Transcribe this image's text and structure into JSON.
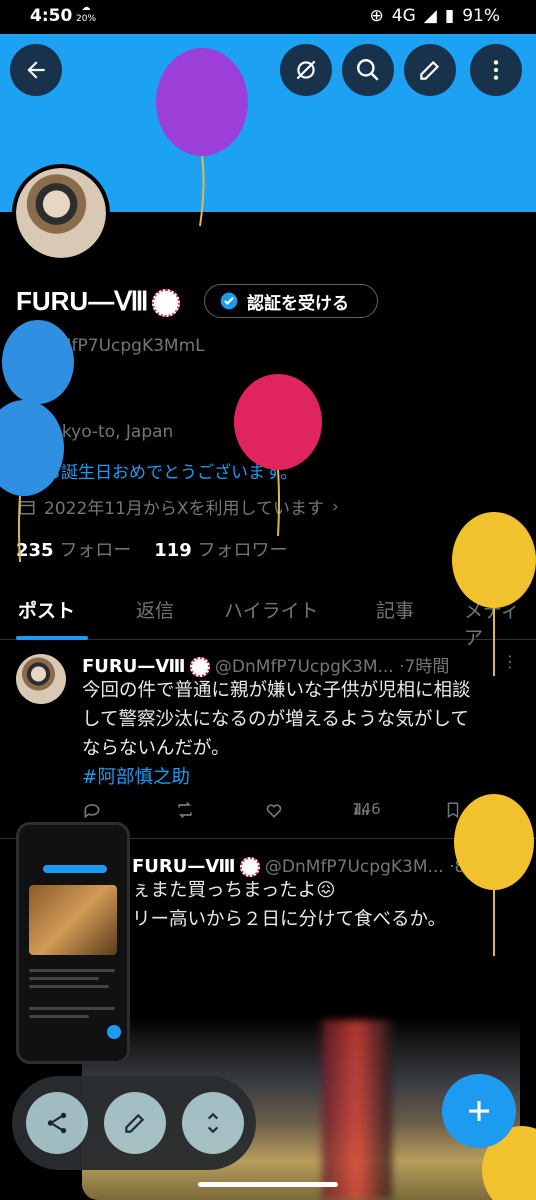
{
  "status_bar": {
    "time": "4:50",
    "weather_pct": "20%",
    "network": "4G",
    "battery": "91%"
  },
  "profile": {
    "display_name": "FURU—Ⅷ",
    "verify_button_label": "認証を受ける",
    "handle": "@DnMfP7UcpgK3MmL",
    "location": "Tokyo-to, Japan",
    "birthday_text": "お誕生日おめでとうございます。",
    "joined": "2022年11月からXを利用しています",
    "following_count": "235",
    "following_label": "フォロー",
    "followers_count": "119",
    "followers_label": "フォロワー"
  },
  "tabs": [
    {
      "label": "ポスト",
      "active": true
    },
    {
      "label": "返信"
    },
    {
      "label": "ハイライト"
    },
    {
      "label": "記事"
    },
    {
      "label": "メディア"
    }
  ],
  "tweets": [
    {
      "name": "FURU—Ⅷ",
      "handle": "@DnMfP7UcpgK3M...",
      "time": "·7時間",
      "body_lines": [
        "今回の件で普通に親が嫌いな子供が児相に相談",
        "して警察沙汰になるのが増えるような気がして",
        "ならないんだが。"
      ],
      "hashtag": "#阿部慎之助",
      "views": "146"
    },
    {
      "name": "FURU—Ⅷ",
      "handle": "@DnMfP7UcpgK3M...",
      "time": "·8時間",
      "body_lines": [
        "ぇまた買っちまったよ😖",
        "リー高いから２日に分けて食べるか。"
      ]
    }
  ],
  "colors": {
    "banner": "#1da1f2",
    "accent": "#1d9bf0",
    "balloon_purple": "#9b3fd8",
    "balloon_blue": "#2f8fe0",
    "balloon_red": "#e0245e",
    "balloon_yellow": "#f2c12e"
  },
  "icons": [
    "back-arrow-icon",
    "hide-retweets-icon",
    "search-icon",
    "edit-icon",
    "more-icon",
    "location-icon",
    "balloon-icon",
    "calendar-icon",
    "reply-icon",
    "retweet-icon",
    "like-icon",
    "views-icon",
    "bookmark-icon",
    "share-icon",
    "plus-icon",
    "pencil-icon",
    "scroll-icon"
  ]
}
